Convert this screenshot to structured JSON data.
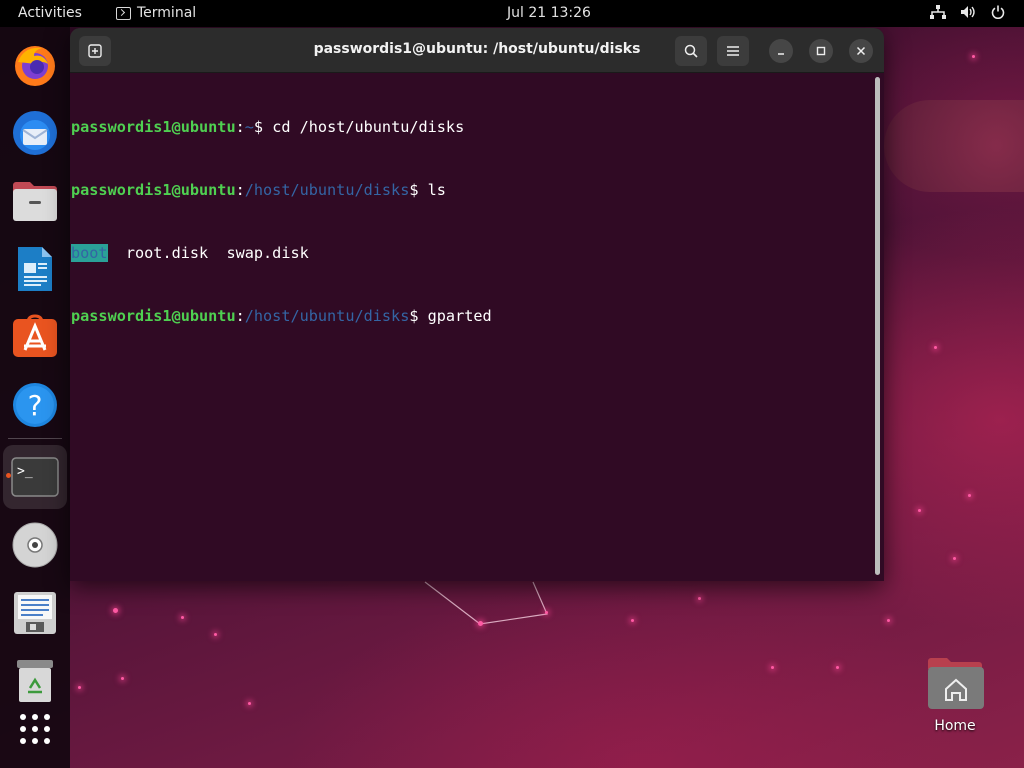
{
  "topbar": {
    "activities_label": "Activities",
    "app_name": "Terminal",
    "clock": "Jul 21  13:26"
  },
  "dock": {
    "apps": [
      {
        "name": "Firefox",
        "icon": "firefox-icon"
      },
      {
        "name": "Thunderbird",
        "icon": "thunderbird-icon"
      },
      {
        "name": "Files",
        "icon": "files-icon"
      },
      {
        "name": "LibreOffice Writer",
        "icon": "writer-icon"
      },
      {
        "name": "Ubuntu Software",
        "icon": "software-icon"
      },
      {
        "name": "Help",
        "icon": "help-icon"
      },
      {
        "name": "Terminal",
        "icon": "terminal-icon",
        "active": true
      },
      {
        "name": "Disc",
        "icon": "disc-icon"
      },
      {
        "name": "Text Editor",
        "icon": "text-editor-icon"
      },
      {
        "name": "Trash",
        "icon": "trash-icon"
      },
      {
        "name": "Show Applications",
        "icon": "app-grid-icon"
      }
    ]
  },
  "terminal": {
    "title": "passwordis1@ubuntu: /host/ubuntu/disks",
    "lines": [
      {
        "user": "passwordis1@ubuntu",
        "path": "~",
        "command": "cd /host/ubuntu/disks"
      },
      {
        "user": "passwordis1@ubuntu",
        "path": "/host/ubuntu/disks",
        "command": "ls"
      },
      {
        "output": [
          "boot",
          "root.disk",
          "swap.disk"
        ]
      },
      {
        "user": "passwordis1@ubuntu",
        "path": "/host/ubuntu/disks",
        "command": "gparted"
      }
    ],
    "prompt_sep": ":",
    "prompt_end": "$ "
  },
  "desktop": {
    "home_label": "Home"
  },
  "colors": {
    "topbar": "#000000",
    "terminal_bg": "#300a24",
    "prompt_user": "#4fd051",
    "prompt_path": "#3465a4",
    "ubuntu_orange": "#e95420"
  }
}
